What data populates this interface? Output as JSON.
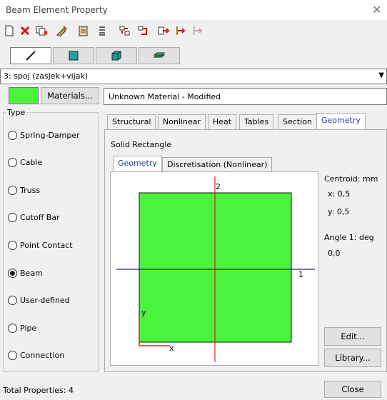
{
  "window": {
    "title": "Beam Element Property",
    "close_glyph": "✕"
  },
  "toolbar": {
    "icons": [
      "new-icon",
      "delete-icon",
      "copy-icon",
      "edit-icon",
      "clipboard-icon",
      "align-icon",
      "split-icon",
      "merge-icon",
      "export-icon",
      "import-icon",
      "disabled-import-icon"
    ]
  },
  "shape_tabs": [
    {
      "icon": "line-icon",
      "active": true
    },
    {
      "icon": "square-icon",
      "active": false
    },
    {
      "icon": "cube-icon",
      "active": false
    },
    {
      "icon": "layers-icon",
      "active": false
    }
  ],
  "property_select": {
    "value": "3: spoj (zasjek+vijak)"
  },
  "material": {
    "color": "#4cf33d",
    "button_label": "Materials...",
    "name": "Unknown Material - Modified"
  },
  "type_group": {
    "label": "Type",
    "options": [
      {
        "label": "Spring-Damper",
        "checked": false
      },
      {
        "label": "Cable",
        "checked": false
      },
      {
        "label": "Truss",
        "checked": false
      },
      {
        "label": "Cutoff Bar",
        "checked": false
      },
      {
        "label": "Point Contact",
        "checked": false
      },
      {
        "label": "Beam",
        "checked": true
      },
      {
        "label": "User-defined",
        "checked": false
      },
      {
        "label": "Pipe",
        "checked": false
      },
      {
        "label": "Connection",
        "checked": false
      }
    ]
  },
  "tabs": [
    "Structural",
    "Nonlinear",
    "Heat",
    "Tables",
    "Section",
    "Geometry"
  ],
  "active_tab": "Geometry",
  "geometry": {
    "section_name": "Solid Rectangle",
    "subtabs": [
      "Geometry",
      "Discretisation (Nonlinear)"
    ],
    "active_subtab": "Geometry",
    "plot": {
      "axis2_label": "2",
      "axis1_label": "1",
      "y_label": "y",
      "x_label": "x",
      "fill_color": "#4cf33d",
      "axis_v_color": "#e02020",
      "axis_h_color": "#1a1aa0"
    },
    "centroid_label": "Centroid: mm",
    "x_value": "x: 0,5",
    "y_value": "y: 0,5",
    "angle_label": "Angle 1: deg",
    "angle_value": "0,0",
    "edit_button": "Edit...",
    "library_button": "Library..."
  },
  "footer": {
    "total_properties": "Total Properties: 4",
    "close_button": "Close"
  }
}
